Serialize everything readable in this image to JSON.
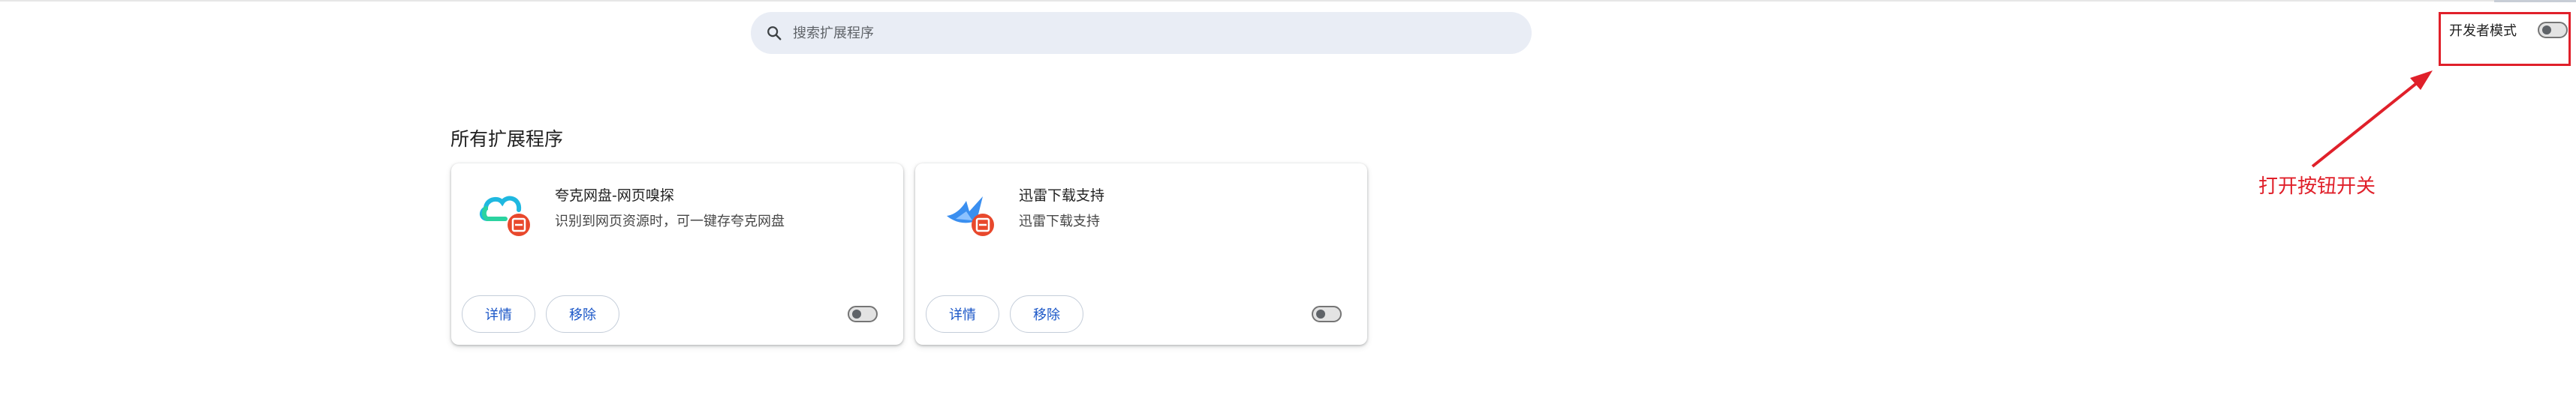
{
  "search": {
    "placeholder": "搜索扩展程序"
  },
  "dev_mode": {
    "label": "开发者模式",
    "enabled": false
  },
  "section_title": "所有扩展程序",
  "extensions": [
    {
      "name": "夸克网盘-网页嗅探",
      "description": "识别到网页资源时，可一键存夸克网盘",
      "details_label": "详情",
      "remove_label": "移除",
      "enabled": false,
      "icon": "quark-cloud-icon"
    },
    {
      "name": "迅雷下载支持",
      "description": "迅雷下载支持",
      "details_label": "详情",
      "remove_label": "移除",
      "enabled": false,
      "icon": "thunder-bird-icon"
    }
  ],
  "annotation": {
    "text": "打开按钮开关",
    "color": "#e0202a"
  },
  "colors": {
    "accent": "#1a56c7",
    "search_bg": "#e9edf5",
    "annotation_red": "#e0202a"
  }
}
